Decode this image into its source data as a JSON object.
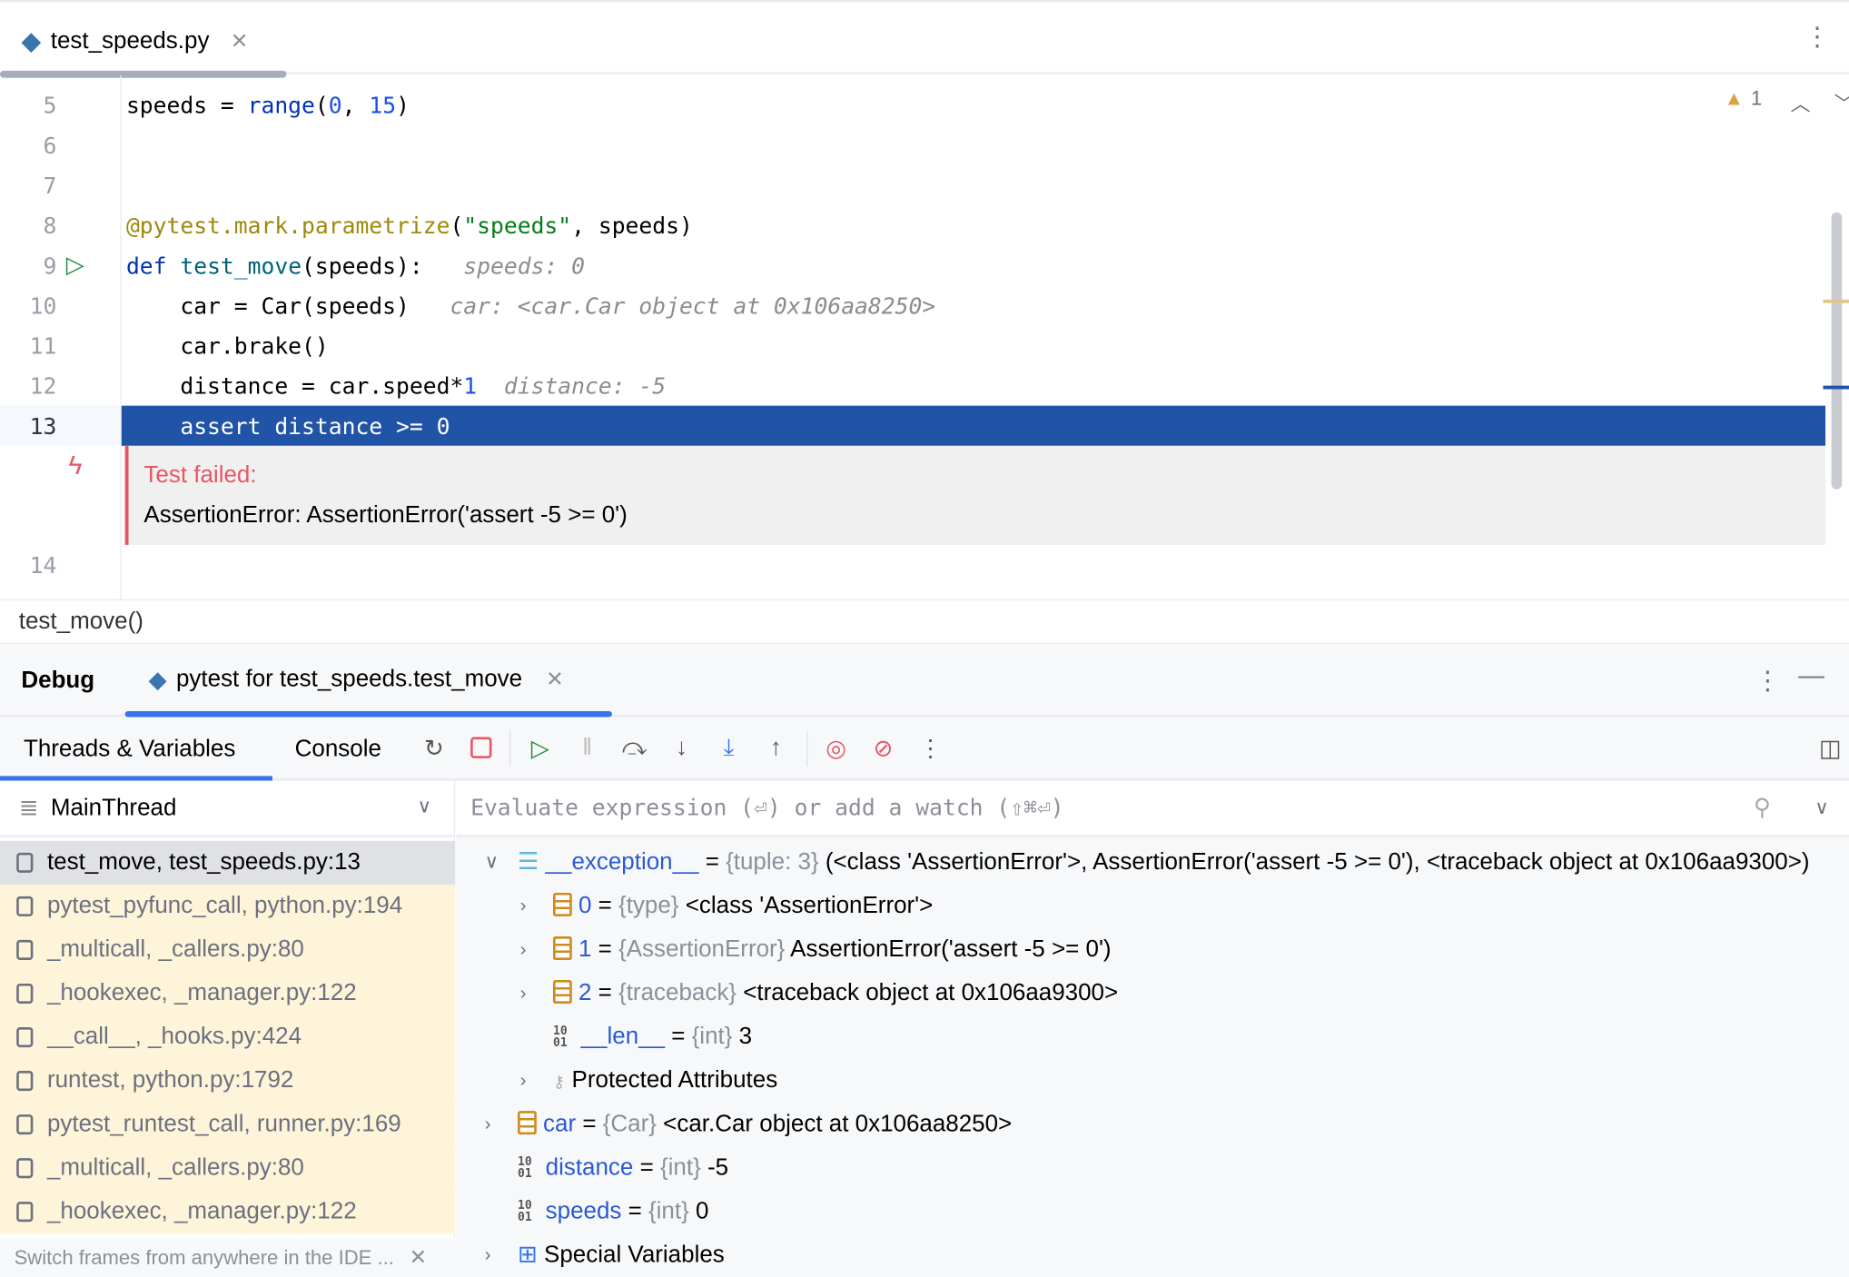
{
  "tab": {
    "file": "test_speeds.py"
  },
  "editor": {
    "warning_count": "1",
    "lines": [
      {
        "n": "5",
        "tokens": [
          [
            "speeds = ",
            ""
          ],
          [
            "range",
            "kw"
          ],
          [
            "(",
            ""
          ],
          [
            "0",
            "num"
          ],
          [
            ", ",
            ""
          ],
          [
            "15",
            "num"
          ],
          [
            ")",
            ""
          ]
        ]
      },
      {
        "n": "6",
        "tokens": []
      },
      {
        "n": "7",
        "tokens": []
      },
      {
        "n": "8",
        "tokens": [
          [
            "@pytest.mark.parametrize",
            "dec"
          ],
          [
            "(",
            ""
          ],
          [
            "\"speeds\"",
            "str"
          ],
          [
            ", speeds)",
            ""
          ]
        ]
      },
      {
        "n": "9",
        "tokens": [
          [
            "def ",
            "kw"
          ],
          [
            "test_move",
            "fn"
          ],
          [
            "(speeds):   ",
            ""
          ],
          [
            "speeds: 0",
            "hint"
          ]
        ]
      },
      {
        "n": "10",
        "tokens": [
          [
            "    car = Car(speeds)   ",
            ""
          ],
          [
            "car: <car.Car object at 0x106aa8250>",
            "hint"
          ]
        ]
      },
      {
        "n": "11",
        "tokens": [
          [
            "    car.brake()",
            ""
          ]
        ]
      },
      {
        "n": "12",
        "tokens": [
          [
            "    distance = car.speed*",
            ""
          ],
          [
            "1",
            "num"
          ],
          [
            "  ",
            ""
          ],
          [
            "distance: -5",
            "hint"
          ]
        ]
      },
      {
        "n": "13",
        "tokens": [
          [
            "    assert distance >= 0",
            ""
          ]
        ]
      }
    ],
    "last_line": "14",
    "error_title": "Test failed:",
    "error_message": "AssertionError: AssertionError('assert -5 >= 0')"
  },
  "breadcrumb": "test_move()",
  "debug": {
    "title": "Debug",
    "session_tab": "pytest for test_speeds.test_move",
    "tabs": [
      "Threads & Variables",
      "Console"
    ],
    "thread": "MainThread",
    "eval_placeholder": "Evaluate expression (⏎) or add a watch (⇧⌘⏎)",
    "frames": [
      "test_move, test_speeds.py:13",
      "pytest_pyfunc_call, python.py:194",
      "_multicall, _callers.py:80",
      "_hookexec, _manager.py:122",
      "__call__, _hooks.py:424",
      "runtest, python.py:1792",
      "pytest_runtest_call, runner.py:169",
      "_multicall, _callers.py:80",
      "_hookexec, _manager.py:122"
    ],
    "frames_hint": "Switch frames from anywhere in the IDE ...",
    "variables": [
      {
        "name": "__exception__",
        "type": "{tuple: 3}",
        "value": "(<class 'AssertionError'>, AssertionError('assert -5 >= 0'), <traceback object at 0x106aa9300>)",
        "indent": 0,
        "expand": "down",
        "icon": "list"
      },
      {
        "name": "0",
        "type": "{type}",
        "value": "<class 'AssertionError'>",
        "indent": 1,
        "expand": "right",
        "icon": "stack"
      },
      {
        "name": "1",
        "type": "{AssertionError}",
        "value": "AssertionError('assert -5 >= 0')",
        "indent": 1,
        "expand": "right",
        "icon": "stack"
      },
      {
        "name": "2",
        "type": "{traceback}",
        "value": "<traceback object at 0x106aa9300>",
        "indent": 1,
        "expand": "right",
        "icon": "stack"
      },
      {
        "name": "__len__",
        "type": "{int}",
        "value": "3",
        "indent": 1,
        "expand": "",
        "icon": "binary"
      },
      {
        "name": "Protected Attributes",
        "type": "",
        "value": "",
        "indent": 1,
        "expand": "right",
        "icon": "key",
        "plain": true
      },
      {
        "name": "car",
        "type": "{Car}",
        "value": "<car.Car object at 0x106aa8250>",
        "indent": 0,
        "expand": "right",
        "icon": "stack"
      },
      {
        "name": "distance",
        "type": "{int}",
        "value": "-5",
        "indent": 0,
        "expand": "",
        "icon": "binary"
      },
      {
        "name": "speeds",
        "type": "{int}",
        "value": "0",
        "indent": 0,
        "expand": "",
        "icon": "binary"
      },
      {
        "name": "Special Variables",
        "type": "",
        "value": "",
        "indent": 0,
        "expand": "right",
        "icon": "grid",
        "plain": true
      }
    ]
  },
  "colors": {
    "accent": "#2154a6",
    "tab_underline": "#3574f0",
    "error": "#e55765",
    "frame_bg": "#fef4da"
  }
}
